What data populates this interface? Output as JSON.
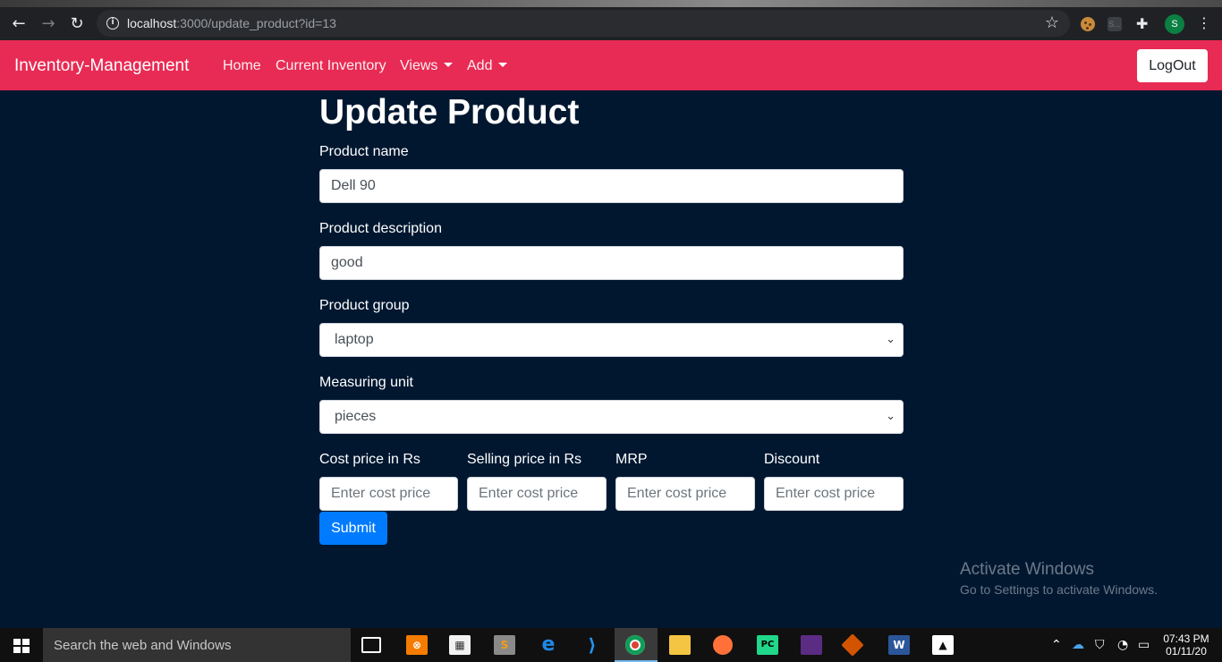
{
  "browser": {
    "url_host": "localhost",
    "url_path": ":3000/update_product?id=13",
    "profile_initial": "S",
    "ext_label": "S..."
  },
  "navbar": {
    "brand": "Inventory-Management",
    "links": {
      "home": "Home",
      "current_inventory": "Current Inventory",
      "views": "Views",
      "add": "Add"
    },
    "logout": "LogOut"
  },
  "form": {
    "title": "Update Product",
    "product_name": {
      "label": "Product name",
      "value": "Dell 90"
    },
    "product_description": {
      "label": "Product description",
      "value": "good"
    },
    "product_group": {
      "label": "Product group",
      "selected": "laptop"
    },
    "measuring_unit": {
      "label": "Measuring unit",
      "selected": "pieces"
    },
    "cost_price": {
      "label": "Cost price in Rs",
      "placeholder": "Enter cost price"
    },
    "selling_price": {
      "label": "Selling price in Rs",
      "placeholder": "Enter cost price"
    },
    "mrp": {
      "label": "MRP",
      "placeholder": "Enter cost price"
    },
    "discount": {
      "label": "Discount",
      "placeholder": "Enter cost price"
    },
    "submit": "Submit"
  },
  "watermark": {
    "title": "Activate Windows",
    "subtitle": "Go to Settings to activate Windows."
  },
  "taskbar": {
    "search_placeholder": "Search the web and Windows",
    "time": "07:43 PM",
    "date": "01/11/20"
  },
  "colors": {
    "navbar": "#e82b54",
    "page_background": "#011730",
    "submit": "#007bff"
  }
}
